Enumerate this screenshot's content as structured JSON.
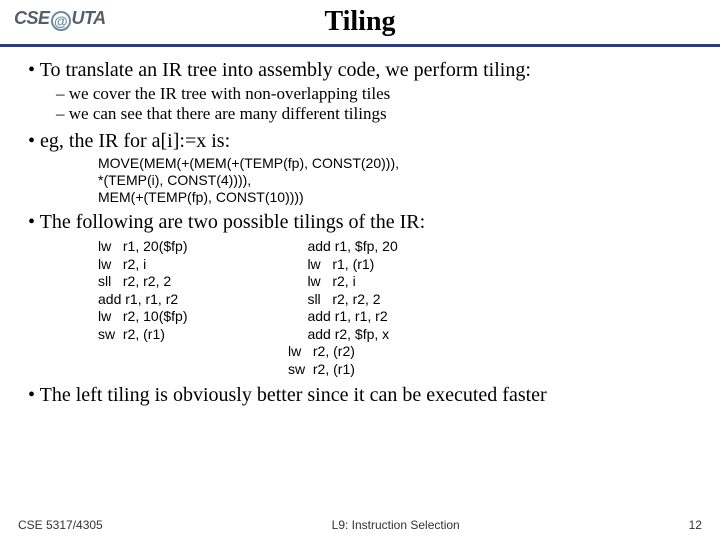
{
  "logo": {
    "left": "CSE",
    "right": "UTA"
  },
  "title": "Tiling",
  "bullets": {
    "b1": "To translate an IR tree into assembly code, we perform tiling:",
    "b1_sub1": "we cover the IR tree with non-overlapping tiles",
    "b1_sub2": "we can see that there are many different tilings",
    "b2": "eg, the IR for   a[i]:=x   is:",
    "ir_line1": "MOVE(MEM(+(MEM(+(TEMP(fp), CONST(20))),",
    "ir_line2": "                     *(TEMP(i), CONST(4)))),",
    "ir_line3": "          MEM(+(TEMP(fp), CONST(10))))",
    "b3": "The following are two possible tilings of the IR:",
    "tiling_left": "lw   r1, 20($fp)\nlw   r2, i\nsll   r2, r2, 2\nadd r1, r1, r2\nlw   r2, 10($fp)\nsw  r2, (r1)",
    "tiling_right": "     add r1, $fp, 20\n     lw   r1, (r1)\n     lw   r2, i\n     sll   r2, r2, 2\n     add r1, r1, r2\n     add r2, $fp, x\nlw   r2, (r2)\nsw  r2, (r1)",
    "b4": "The left tiling is obviously better since it can be executed faster"
  },
  "footer": {
    "course": "CSE 5317/4305",
    "lecture": "L9: Instruction Selection",
    "page": "12"
  }
}
